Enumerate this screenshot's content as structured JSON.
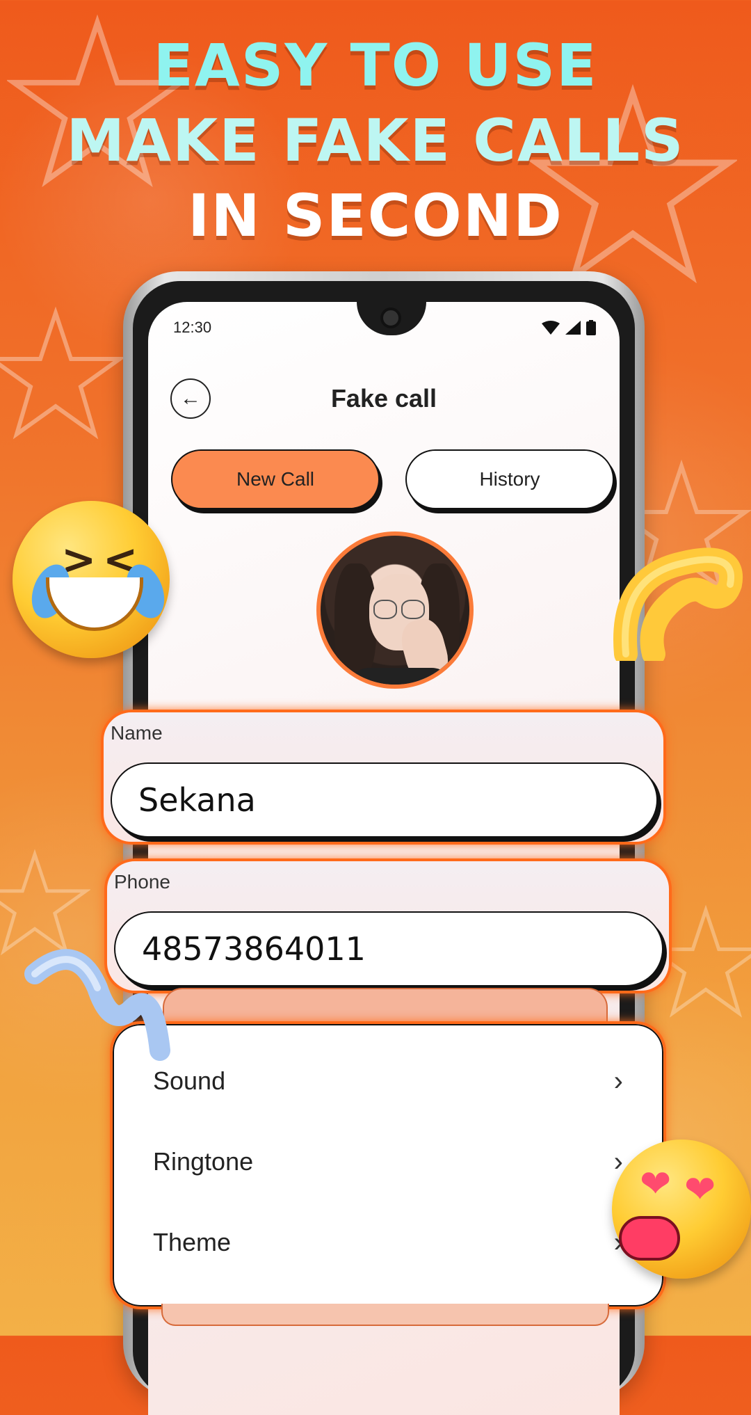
{
  "headline": {
    "line1": "EASY TO USE",
    "line2": "MAKE FAKE CALLS",
    "line3": "IN SECOND"
  },
  "status_bar": {
    "time": "12:30",
    "icons": [
      "wifi-icon",
      "signal-icon",
      "battery-icon"
    ]
  },
  "header": {
    "back_icon": "arrow-left-icon",
    "title": "Fake call"
  },
  "tabs": [
    {
      "label": "New Call",
      "active": true
    },
    {
      "label": "History",
      "active": false
    }
  ],
  "form": {
    "name_label": "Name",
    "name_value": "Sekana",
    "phone_label": "Phone",
    "phone_value": "48573864011"
  },
  "menu": [
    {
      "label": "Sound",
      "icon": "chevron-right-icon"
    },
    {
      "label": "Ringtone",
      "icon": "chevron-right-icon"
    },
    {
      "label": "Theme",
      "icon": "chevron-right-icon"
    }
  ],
  "colors": {
    "accent": "#fb8a50",
    "glow": "#ff6a1a",
    "headline_cyan": "#8ff3ef"
  }
}
